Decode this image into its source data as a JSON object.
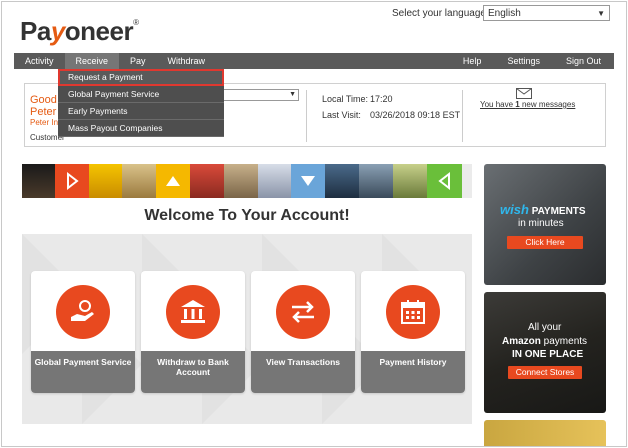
{
  "brand": {
    "logo_pre": "Pa",
    "logo_y": "y",
    "logo_post": "oneer",
    "reg": "®"
  },
  "language": {
    "label": "Select your language:",
    "selected": "English"
  },
  "nav": {
    "left": [
      "Activity",
      "Receive",
      "Pay",
      "Withdraw"
    ],
    "right": [
      "Help",
      "Settings",
      "Sign Out"
    ],
    "active": "Receive"
  },
  "receive_menu": [
    "Request a Payment",
    "Global Payment Service",
    "Early Payments",
    "Mass Payout Companies"
  ],
  "account": {
    "greeting": "Good",
    "name": "Peter",
    "company": "Peter In",
    "customer": "Customer",
    "local_time_label": "Local Time:",
    "local_time": "17:20",
    "last_visit_label": "Last Visit:",
    "last_visit": "03/26/2018 09:18 EST",
    "messages_pre": "You have ",
    "messages_count": "1",
    "messages_post": " new messages"
  },
  "welcome": "Welcome To Your Account!",
  "actions": [
    {
      "label": "Global Payment Service"
    },
    {
      "label": "Withdraw to Bank Account"
    },
    {
      "label": "View Transactions"
    },
    {
      "label": "Payment History"
    }
  ],
  "ads": {
    "wish": {
      "brand": "wish",
      "title": "PAYMENTS",
      "sub": "in minutes",
      "button": "Click Here"
    },
    "amazon": {
      "line1": "All your",
      "brand": "Amazon",
      "line2": " payments",
      "line3": "IN ONE PLACE",
      "button": "Connect Stores"
    }
  },
  "colors": {
    "accent": "#e8491f",
    "nav_bg": "#5a5a5a",
    "highlight": "#e0382f",
    "wish_blue": "#2fb7ec"
  }
}
